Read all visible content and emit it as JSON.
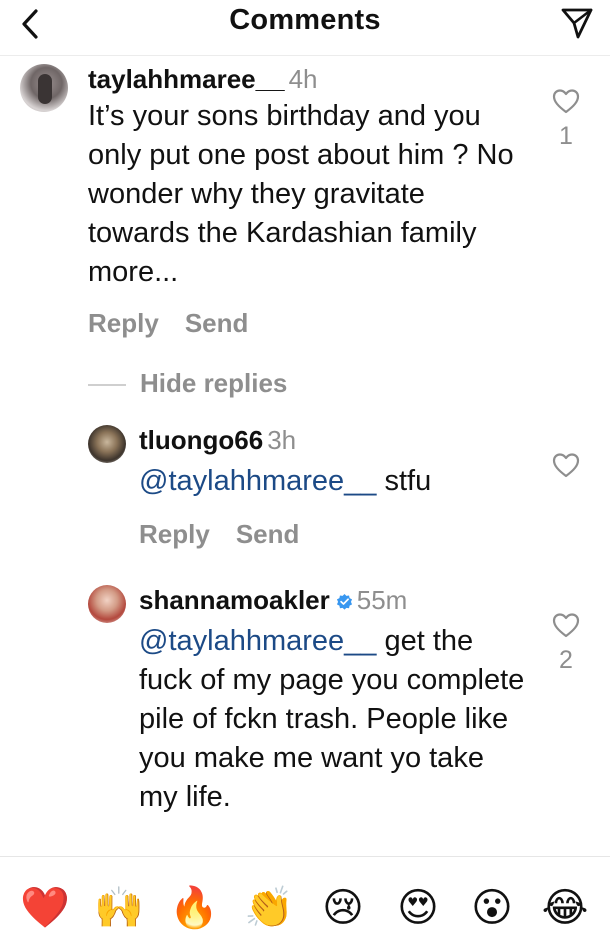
{
  "header": {
    "title": "Comments",
    "back_icon": "chevron-left-icon",
    "send_icon": "paper-plane-icon"
  },
  "comments": [
    {
      "username": "taylahhmaree__",
      "time": "4h",
      "text": "It’s your sons birthday and you only put one post about him ? No wonder why they gravitate towards the Kardashian family more...",
      "likes": "1",
      "reply_label": "Reply",
      "send_label": "Send"
    }
  ],
  "replies_toggle": {
    "label": "Hide replies"
  },
  "replies": [
    {
      "username": "tluongo66",
      "time": "3h",
      "mention": "@taylahhmaree__",
      "text": " stfu",
      "reply_label": "Reply",
      "send_label": "Send"
    },
    {
      "username": "shannamoakler",
      "verified": true,
      "time": "55m",
      "mention": "@taylahhmaree__",
      "text": " get the fuck of my page you complete pile of fckn trash. People like you make me want yo take my life.",
      "likes": "2"
    }
  ],
  "emoji_bar": {
    "emojis": [
      "❤️",
      "🙌",
      "🔥",
      "👏",
      "😢",
      "😍",
      "😮",
      "😂"
    ],
    "icons": [
      "red-heart-icon",
      "raising-hands-icon",
      "fire-icon",
      "clapping-hands-icon",
      "crying-face-icon",
      "heart-eyes-icon",
      "surprised-face-icon",
      "tears-of-joy-icon"
    ]
  },
  "colors": {
    "mention": "#1c4a86",
    "secondary_text": "#8e8e8e",
    "verified": "#3897f0"
  }
}
